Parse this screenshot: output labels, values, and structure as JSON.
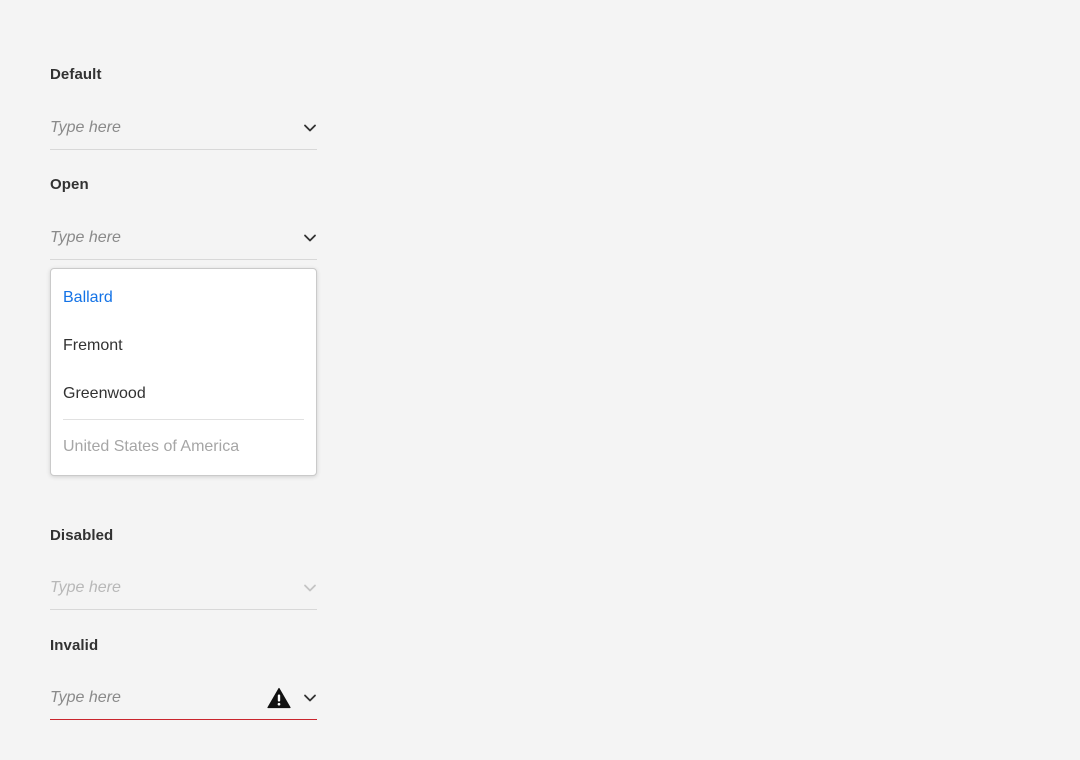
{
  "sections": {
    "default": {
      "label": "Default",
      "placeholder": "Type here"
    },
    "open": {
      "label": "Open",
      "placeholder": "Type here",
      "menu": {
        "items": [
          {
            "label": "Ballard",
            "state": "selected"
          },
          {
            "label": "Fremont",
            "state": "normal"
          },
          {
            "label": "Greenwood",
            "state": "normal"
          }
        ],
        "footer_item": {
          "label": "United States of America",
          "state": "disabled"
        }
      }
    },
    "disabled": {
      "label": "Disabled",
      "placeholder": "Type here"
    },
    "invalid": {
      "label": "Invalid",
      "placeholder": "Type here"
    }
  },
  "colors": {
    "background": "#f4f4f4",
    "accent": "#1473e6",
    "error": "#c9252d",
    "text": "#323232",
    "placeholder": "#8a8a8a"
  },
  "icons": {
    "chevron": "chevron-down-icon",
    "alert": "alert-triangle-icon"
  }
}
